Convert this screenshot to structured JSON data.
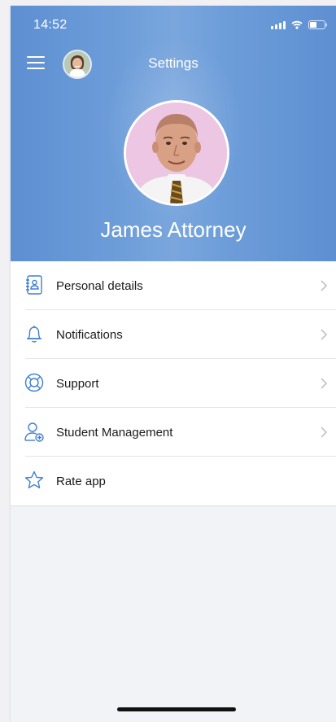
{
  "status_bar": {
    "time": "14:52"
  },
  "header": {
    "title": "Settings"
  },
  "profile": {
    "name": "James Attorney"
  },
  "menu": {
    "items": [
      {
        "label": "Personal details",
        "icon": "contact-card-icon",
        "has_chevron": true
      },
      {
        "label": "Notifications",
        "icon": "bell-icon",
        "has_chevron": true
      },
      {
        "label": "Support",
        "icon": "lifebuoy-icon",
        "has_chevron": true
      },
      {
        "label": "Student Management",
        "icon": "add-user-icon",
        "has_chevron": true
      },
      {
        "label": "Rate app",
        "icon": "star-icon",
        "has_chevron": false
      }
    ]
  },
  "colors": {
    "header_blue": "#6a9bd8",
    "icon_blue": "#3f7fd0",
    "chevron": "#b9bcc4"
  }
}
